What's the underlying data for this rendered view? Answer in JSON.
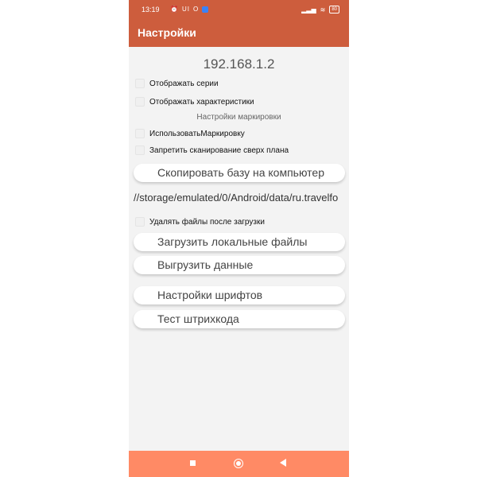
{
  "status_bar": {
    "time": "13:19",
    "icons_left": [
      "alarm-icon",
      "UI",
      "O",
      "app-icon"
    ],
    "battery": "80"
  },
  "app": {
    "title": "Настройки",
    "accent": "#cd5d3d",
    "nav_color": "#ff8a65"
  },
  "server": {
    "ip": "192.168.1.2"
  },
  "options": [
    {
      "label": "Отображать серии",
      "checked": false
    },
    {
      "label": "Отображать характеристики",
      "checked": false
    }
  ],
  "marking_section": "Настройки маркировки",
  "marking_options": [
    {
      "label": "ИспользоватьМаркировку",
      "checked": false
    },
    {
      "label": "Запретить сканирование сверх плана",
      "checked": false
    }
  ],
  "buttons": {
    "copy_db": "Скопировать базу на компьютер",
    "load_local": "Загрузить локальные файлы",
    "export_data": "Выгрузить данные",
    "font_settings": "Настройки шрифтов",
    "barcode_test": "Тест штрихкода"
  },
  "storage_path": "//storage/emulated/0/Android/data/ru.travelfo",
  "delete_option": {
    "label": "Удалять файлы после загрузки",
    "checked": false
  }
}
